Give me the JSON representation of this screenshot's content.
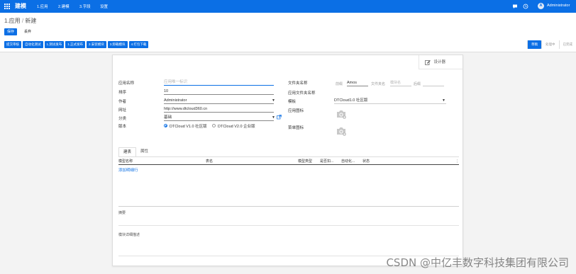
{
  "topbar": {
    "brand": "建模",
    "menu": [
      "1.应用",
      "2.建模",
      "3.字段",
      "设置"
    ],
    "user_initial": "A",
    "user": "Administrator",
    "icons": [
      "apps-grid-icon",
      "chat-icon",
      "clock-icon"
    ]
  },
  "breadcrumb": {
    "parent": "1.应用",
    "separator": "/",
    "current": "新建"
  },
  "actions": {
    "save": "保存",
    "discard": "丢弃"
  },
  "workflow_buttons": [
    "提交审核",
    "自动化测试",
    "1.测试发布",
    "1.正式发布",
    "2.安装模块",
    "3.卸载模块",
    "4.打包下载"
  ],
  "statusbar": [
    {
      "label": "草稿",
      "active": true
    },
    {
      "label": "处理中",
      "active": false
    },
    {
      "label": "已完成",
      "active": false
    }
  ],
  "form": {
    "designer": "设计器",
    "left": {
      "app_name": {
        "label": "应用名称",
        "placeholder": "应用唯一标识"
      },
      "sequence": {
        "label": "排序",
        "value": "10"
      },
      "author": {
        "label": "作者",
        "value": "Administrator"
      },
      "website": {
        "label": "网址",
        "value": "http://www.dtcloud360.cn"
      },
      "category": {
        "label": "分类",
        "value": "基础"
      },
      "version": {
        "label": "版本",
        "options": [
          "DTCloud V1.0 社区版",
          "DTCloud V2.0 企业版"
        ],
        "selected": 0
      }
    },
    "right": {
      "folder": {
        "label": "文件夹名称",
        "prefix_label": "前缀",
        "prefix_value": "Amos",
        "folder_label": "文件夹名",
        "folder_placeholder": "模块名",
        "suffix_label": "后缀"
      },
      "app_folder_label": "应用文件夹名称",
      "template": {
        "label": "模板",
        "value": "DTCloud1.0 社区版"
      },
      "app_icon_label": "应用图标",
      "menu_icon_label": "菜单图标"
    },
    "tabs": [
      {
        "label": "建表",
        "active": true
      },
      {
        "label": "属性",
        "active": false
      }
    ],
    "table": {
      "columns": [
        "模型名称",
        "表名",
        "模型类型",
        "是否扣...",
        "自动化...",
        "状态"
      ],
      "add_line": "添加明细行"
    },
    "summary_label": "摘要",
    "description_label": "模块详细描述"
  },
  "watermark": "CSDN @中亿丰数字科技集团有限公司",
  "colors": {
    "primary": "#0b6fe5"
  }
}
